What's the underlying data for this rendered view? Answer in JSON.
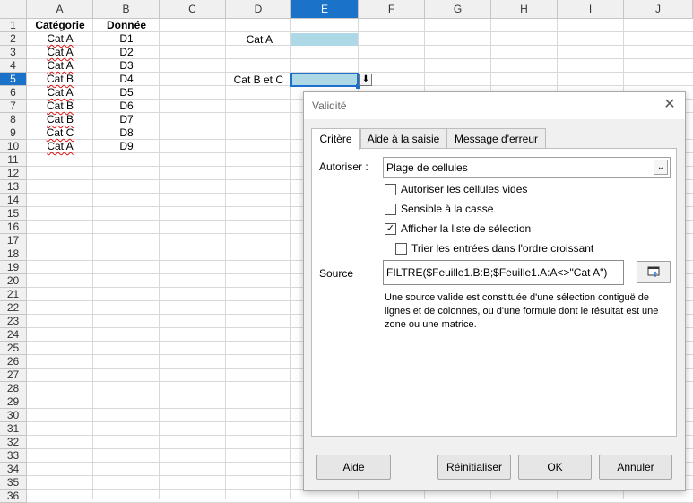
{
  "sheet": {
    "columns": [
      "A",
      "B",
      "C",
      "D",
      "E",
      "F",
      "G",
      "H",
      "I",
      "J"
    ],
    "selected_column": "E",
    "rows": [
      "1",
      "2",
      "3",
      "4",
      "5",
      "6",
      "7",
      "8",
      "9",
      "10",
      "11",
      "12",
      "13",
      "14",
      "15",
      "16",
      "17",
      "18",
      "19",
      "20",
      "21",
      "22",
      "23",
      "24",
      "25",
      "26",
      "27",
      "28",
      "29",
      "30",
      "31",
      "32",
      "33",
      "34",
      "35",
      "36"
    ],
    "selected_row": "5",
    "header_a": "Catégorie",
    "header_b": "Donnée",
    "data_a": [
      "Cat A",
      "Cat A",
      "Cat A",
      "Cat B",
      "Cat A",
      "Cat B",
      "Cat B",
      "Cat C",
      "Cat A"
    ],
    "data_b": [
      "D1",
      "D2",
      "D3",
      "D4",
      "D5",
      "D6",
      "D7",
      "D8",
      "D9"
    ],
    "d2_label": "Cat A",
    "d5_label": "Cat B et C",
    "fill_color": "#add8e6",
    "dropdown_glyph": "⬇"
  },
  "dialog": {
    "title": "Validité",
    "close_glyph": "✕",
    "tabs": [
      "Critère",
      "Aide à la saisie",
      "Message d'erreur"
    ],
    "allow_label": "Autoriser :",
    "allow_value": "Plage de cellules",
    "dropdown_arrow": "⌄",
    "checkboxes": [
      {
        "label": "Autoriser les cellules vides",
        "checked": false
      },
      {
        "label": "Sensible à la casse",
        "checked": false
      },
      {
        "label": "Afficher la liste de sélection",
        "checked": true
      },
      {
        "label": "Trier les entrées dans l'ordre croissant",
        "checked": false
      }
    ],
    "check_glyph": "✓",
    "source_label": "Source",
    "source_value": "FILTRE($Feuille1.B:B;$Feuille1.A:A<>\"Cat A\")",
    "help_text": "Une source valide est constituée d'une sélection contiguë de lignes et de colonnes, ou d'une formule dont le résultat est une zone ou une matrice.",
    "buttons": {
      "help": "Aide",
      "reset": "Réinitialiser",
      "ok": "OK",
      "cancel": "Annuler"
    }
  }
}
